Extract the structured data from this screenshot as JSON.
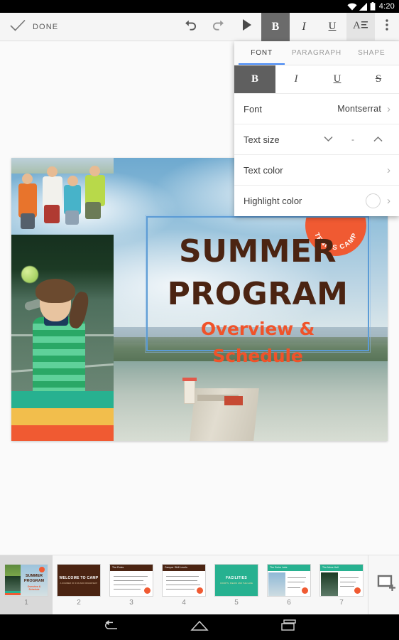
{
  "status_bar": {
    "time": "4:20",
    "icons": [
      "wifi-icon",
      "signal-icon",
      "battery-icon"
    ]
  },
  "toolbar": {
    "done_label": "DONE",
    "done_icon": "check-icon",
    "undo_icon": "undo-icon",
    "redo_icon": "redo-icon",
    "present_icon": "play-icon",
    "bold_label": "B",
    "italic_label": "I",
    "underline_label": "U",
    "format_icon": "text-format-icon",
    "overflow_icon": "more-vert-icon",
    "bold_active": true,
    "format_active": true
  },
  "format_panel": {
    "tabs": [
      {
        "label": "FONT",
        "selected": true
      },
      {
        "label": "PARAGRAPH",
        "selected": false
      },
      {
        "label": "SHAPE",
        "selected": false
      }
    ],
    "style_buttons": [
      {
        "label": "B",
        "name": "bold",
        "active": true
      },
      {
        "label": "I",
        "name": "italic",
        "active": false
      },
      {
        "label": "U",
        "name": "underline",
        "active": false
      },
      {
        "label": "S",
        "name": "strikethrough",
        "active": false
      }
    ],
    "rows": {
      "font": {
        "label": "Font",
        "value": "Montserrat"
      },
      "text_size": {
        "label": "Text size",
        "value": "-",
        "decrease_icon": "chevron-down-icon",
        "increase_icon": "chevron-up-icon"
      },
      "text_color": {
        "label": "Text color"
      },
      "highlight_color": {
        "label": "Highlight color",
        "swatch": "#ffffff"
      }
    },
    "accent_color": "#4285f4"
  },
  "slide": {
    "title_line1": "SUMMER",
    "title_line2": "PROGRAM",
    "subtitle": "Overview & Schedule",
    "badge_text": "TENNIS CAMP",
    "title_color": "#4b2412",
    "subtitle_color": "#f0532a",
    "badge_color": "#f05a32",
    "selection_color": "#5b9bd5",
    "band_colors": [
      "#27b190",
      "#f2be4c",
      "#f05a32"
    ]
  },
  "filmstrip": {
    "add_slide_icon": "add-slide-icon",
    "slides": [
      {
        "number": "1",
        "selected": true,
        "kind": "title",
        "title": "SUMMER PROGRAM",
        "subtitle": "Overview & Schedule"
      },
      {
        "number": "2",
        "selected": false,
        "kind": "brown-center",
        "title": "WELCOME TO CAMP",
        "subtitle": "A SUMMER OF FUN AND FRIENDSHIP"
      },
      {
        "number": "3",
        "selected": false,
        "kind": "bullets-brown",
        "title": "The Rules"
      },
      {
        "number": "4",
        "selected": false,
        "kind": "bullets-brown",
        "title": "Camper Skill Levels"
      },
      {
        "number": "5",
        "selected": false,
        "kind": "teal-center",
        "title": "FACILITIES",
        "subtitle": "COURTS, FIELDS AND THE LAKE"
      },
      {
        "number": "6",
        "selected": false,
        "kind": "photo-teal",
        "title": "The Swim Lake"
      },
      {
        "number": "7",
        "selected": false,
        "kind": "photo-teal",
        "title": "The Mess Hall"
      }
    ]
  },
  "navbar": {
    "back_icon": "back-icon",
    "home_icon": "home-icon",
    "recents_icon": "recents-icon"
  }
}
